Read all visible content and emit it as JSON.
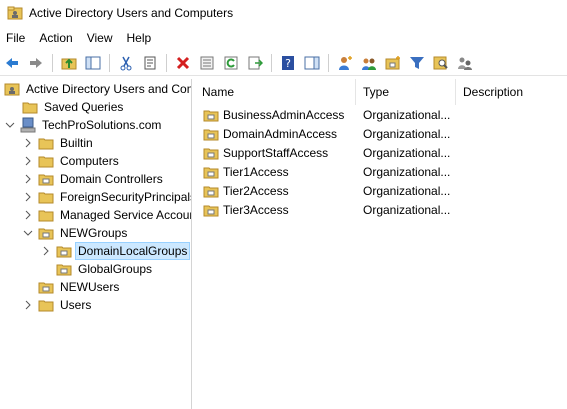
{
  "window": {
    "title": "Active Directory Users and Computers"
  },
  "menubar": {
    "items": [
      "File",
      "Action",
      "View",
      "Help"
    ]
  },
  "tree": {
    "root": "Active Directory Users and Com",
    "saved_queries": "Saved Queries",
    "domain": "TechProSolutions.com",
    "children": {
      "builtin": "Builtin",
      "computers": "Computers",
      "domain_controllers": "Domain Controllers",
      "foreign": "ForeignSecurityPrincipals",
      "managed": "Managed Service Accour",
      "newgroups": "NEWGroups",
      "domainlocal": "DomainLocalGroups",
      "global": "GlobalGroups",
      "newusers": "NEWUsers",
      "users": "Users"
    }
  },
  "list": {
    "columns": {
      "name": "Name",
      "type": "Type",
      "description": "Description"
    },
    "rows": [
      {
        "name": "BusinessAdminAccess",
        "type": "Organizational..."
      },
      {
        "name": "DomainAdminAccess",
        "type": "Organizational..."
      },
      {
        "name": "SupportStaffAccess",
        "type": "Organizational..."
      },
      {
        "name": "Tier1Access",
        "type": "Organizational..."
      },
      {
        "name": "Tier2Access",
        "type": "Organizational..."
      },
      {
        "name": "Tier3Access",
        "type": "Organizational..."
      }
    ]
  },
  "colors": {
    "selection": "#cce8ff",
    "folder": "#e8c458",
    "back_arrow": "#2b7bd1"
  }
}
